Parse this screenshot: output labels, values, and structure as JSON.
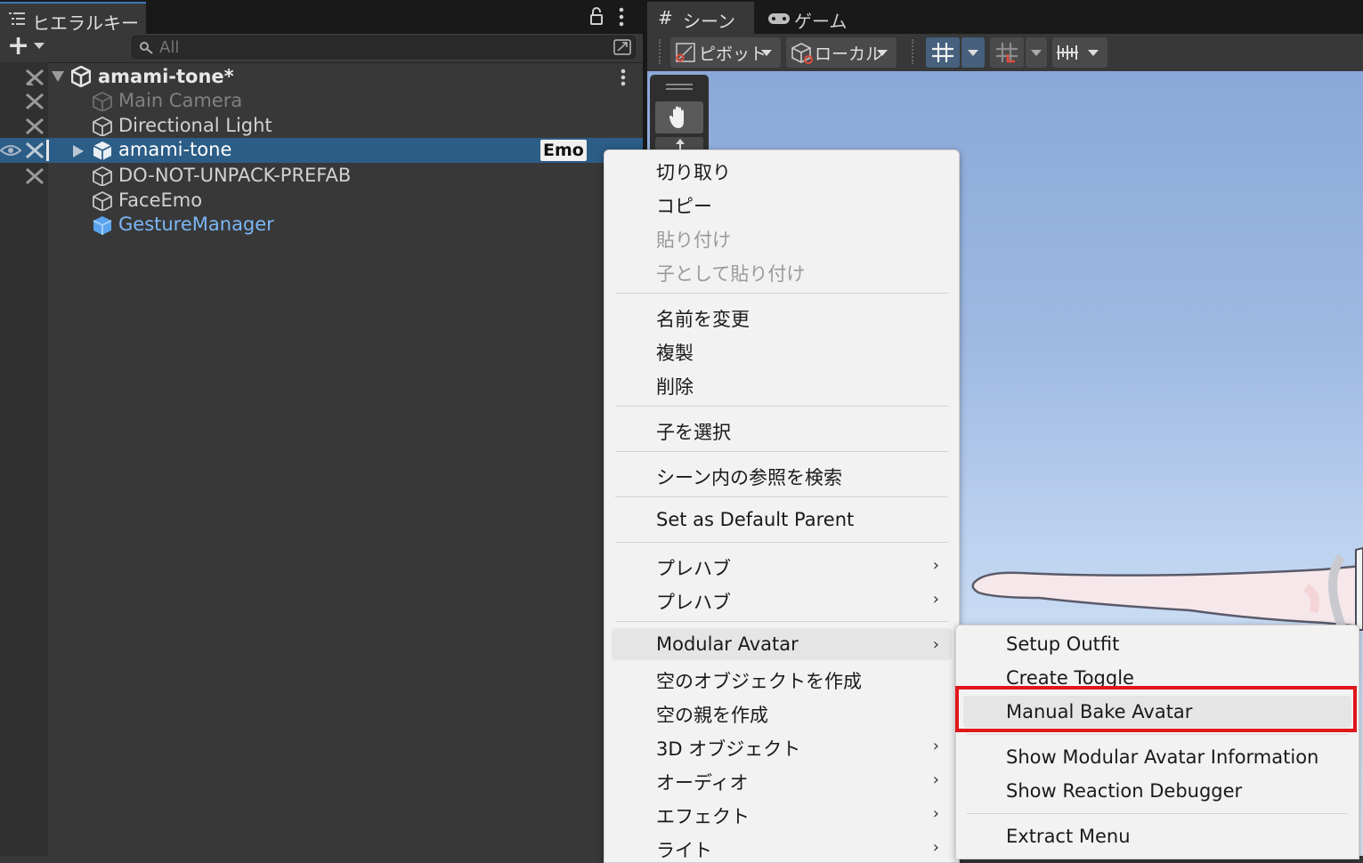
{
  "hierarchy": {
    "tab_title": "ヒエラルキー",
    "add_button": "+",
    "search_placeholder": "All",
    "scene_root": "amami-tone*",
    "items": [
      {
        "name": "Main Camera",
        "color": "#808080"
      },
      {
        "name": "Directional Light",
        "color": "#d2d2d2"
      },
      {
        "name": "amami-tone",
        "color": "#ffffff"
      },
      {
        "name": "DO-NOT-UNPACK-PREFAB",
        "color": "#d2d2d2"
      },
      {
        "name": "FaceEmo",
        "color": "#d2d2d2"
      },
      {
        "name": "GestureManager",
        "color": "#7bb6f5"
      }
    ],
    "emo_badge": "Emo"
  },
  "scene": {
    "tab_scene": "シーン",
    "tab_game": "ゲーム",
    "pivot_label": "ピボット",
    "local_label": "ローカル"
  },
  "context_menu": {
    "items": {
      "cut": "切り取り",
      "copy": "コピー",
      "paste": "貼り付け",
      "paste_as_child": "子として貼り付け",
      "rename": "名前を変更",
      "duplicate": "複製",
      "delete": "削除",
      "select_children": "子を選択",
      "find_references": "シーン内の参照を検索",
      "set_default_parent": "Set as Default Parent",
      "prefab_1": "プレハブ",
      "prefab_2": "プレハブ",
      "modular_avatar": "Modular Avatar",
      "create_empty": "空のオブジェクトを作成",
      "create_empty_parent": "空の親を作成",
      "object_3d": "3D オブジェクト",
      "audio": "オーディオ",
      "effects": "エフェクト",
      "light": "ライト"
    }
  },
  "submenu": {
    "setup_outfit": "Setup Outfit",
    "create_toggle": "Create Toggle",
    "manual_bake": "Manual Bake Avatar",
    "show_info": "Show Modular Avatar Information",
    "reaction_debugger": "Show Reaction Debugger",
    "extract_menu": "Extract Menu",
    "highlight_color": "#e0161b"
  }
}
